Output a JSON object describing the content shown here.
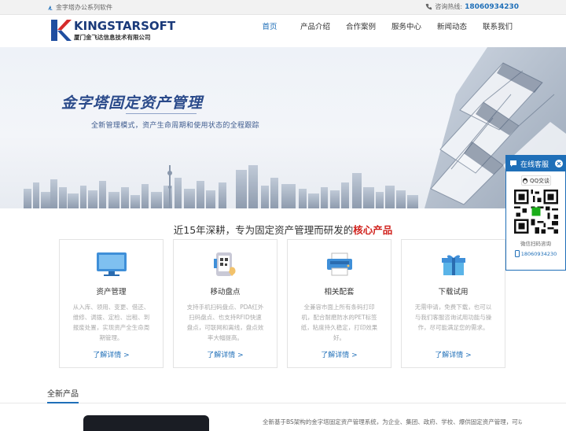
{
  "topbar": {
    "slogan": "金字塔办公系列软件",
    "hotline_label": "咨询热线:",
    "hotline": "18060934230"
  },
  "logo": {
    "name": "KINGSTARSOFT",
    "company": "厦门金飞达信息技术有限公司",
    "colors": {
      "k_red": "#d62b2b",
      "k_blue": "#1f4ea0"
    }
  },
  "nav": {
    "items": [
      {
        "label": "首页",
        "active": true
      },
      {
        "label": "产品介绍",
        "active": false
      },
      {
        "label": "合作案例",
        "active": false
      },
      {
        "label": "服务中心",
        "active": false
      },
      {
        "label": "新闻动态",
        "active": false
      },
      {
        "label": "联系我们",
        "active": false
      }
    ]
  },
  "banner": {
    "title": "金字塔固定资产管理",
    "subtitle": "全新管理模式，资产生命周期和使用状态的全程跟踪"
  },
  "section": {
    "title_prefix": "近15年深耕，专为固定资产管理而研发的",
    "title_highlight": "核心产品"
  },
  "cards": [
    {
      "icon": "monitor-icon",
      "title": "资产管理",
      "desc": "从入库、领用、变更、借还、维修、调拨、定检、出租、到报废处置，实现资产全生命周期管理。",
      "more": "了解详情 >"
    },
    {
      "icon": "mobile-scan-icon",
      "title": "移动盘点",
      "desc": "支持手机扫码盘点、PDA红外扫码盘点、也支持RFID快速盘点，可联网和离线，盘点效率大幅提高。",
      "more": "了解详情 >"
    },
    {
      "icon": "printer-icon",
      "title": "相关配套",
      "desc": "全兼容市面上所有条码打印机，配合耐磨防水的PET标签纸，粘度持久稳定，打印效果好。",
      "more": "了解详情 >"
    },
    {
      "icon": "gift-download-icon",
      "title": "下载试用",
      "desc": "无需申请，免费下载，也可以与我们客服咨询试用功能与操作，尽可能满足您的需求。",
      "more": "了解详情 >"
    }
  ],
  "new_products": {
    "title": "全新产品",
    "desc": "全新基于BS架构的金字塔固定资产管理系统，为企业、集团、政府、学校、爆供固定资产管理，可以由"
  },
  "float_panel": {
    "title": "在线客服",
    "qq_label": "QQ交谈",
    "qr_label": "微信扫码咨询",
    "tel": "18060934230"
  },
  "colors": {
    "accent": "#1f6fb8",
    "highlight": "#d0201b"
  }
}
